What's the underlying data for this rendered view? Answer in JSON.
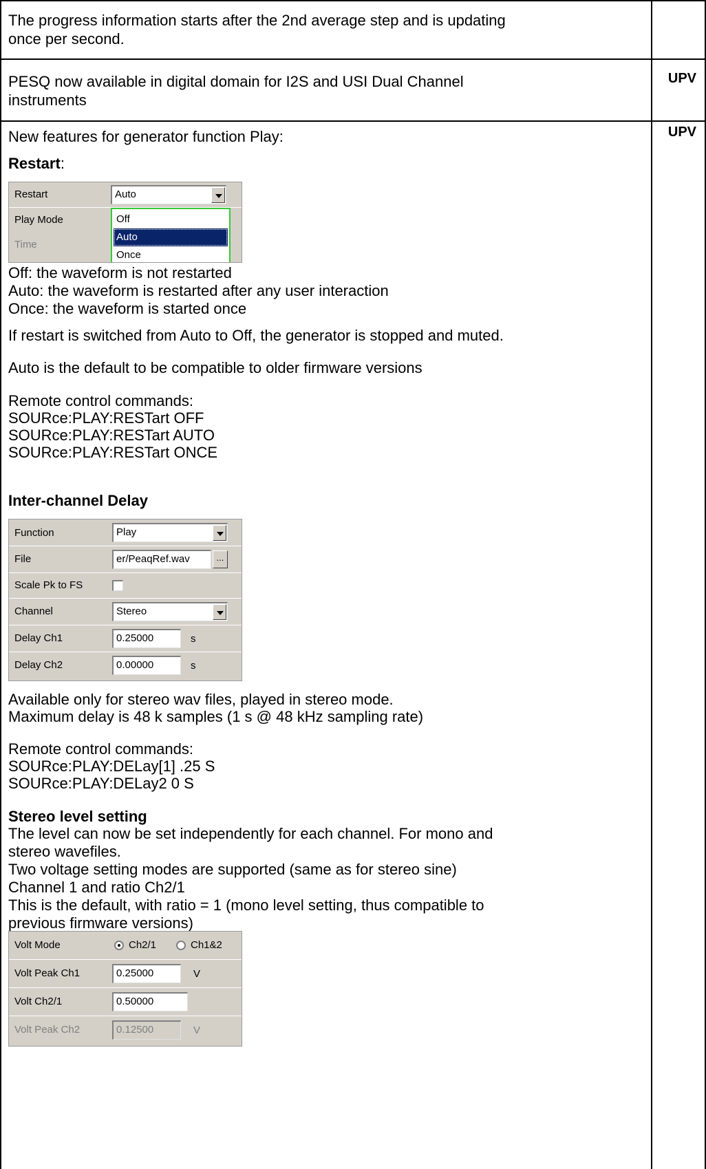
{
  "row1": {
    "lines": [
      "The progress information starts after the 2nd average step and is updating",
      "once per second."
    ],
    "tag": ""
  },
  "row2": {
    "lines": [
      "PESQ now available in digital domain for I2S and USI Dual Channel",
      "instruments"
    ],
    "tag": "UPV"
  },
  "row3": {
    "tag": "UPV",
    "intro": "New features for generator function Play:",
    "restart_heading": "Restart",
    "restart_heading_colon": ":",
    "restart_dialog": {
      "rows": [
        {
          "label": "Restart",
          "value": "Auto"
        },
        {
          "label": "Play Mode"
        },
        {
          "label": "Time"
        }
      ],
      "dropdown_options": [
        "Off",
        "Auto",
        "Once"
      ],
      "selected_option": "Auto"
    },
    "restart_desc": [
      "Off: the waveform is not restarted",
      "Auto: the waveform is restarted after any user interaction",
      "Once: the waveform is started once"
    ],
    "restart_note1": "If restart is switched from Auto to Off, the generator is stopped and muted.",
    "restart_note2": "Auto is the default to be compatible to older firmware versions",
    "restart_remote": [
      "Remote control commands:",
      "SOURce:PLAY:RESTart OFF",
      "SOURce:PLAY:RESTart AUTO",
      "SOURce:PLAY:RESTart ONCE"
    ],
    "delay_heading": "Inter-channel Delay",
    "delay_dialog": {
      "function_label": "Function",
      "function_value": "Play",
      "file_label": "File",
      "file_value": "er/PeaqRef.wav",
      "file_button": "...",
      "scale_label": "Scale Pk to FS",
      "channel_label": "Channel",
      "channel_value": "Stereo",
      "delay1_label": "Delay Ch1",
      "delay1_value": "0.25000",
      "delay1_unit": "s",
      "delay2_label": "Delay Ch2",
      "delay2_value": "0.00000",
      "delay2_unit": "s"
    },
    "delay_desc": [
      "Available only for stereo wav files, played in stereo mode.",
      "Maximum delay is 48 k samples (1 s @ 48 kHz sampling rate)"
    ],
    "delay_remote": [
      "Remote control commands:",
      "SOURce:PLAY:DELay[1] .25 S",
      "SOURce:PLAY:DELay2 0 S"
    ],
    "stereo_heading": "Stereo level setting",
    "stereo_desc": [
      "The level can now be set independently for each channel. For mono and",
      "stereo wavefiles.",
      "Two voltage setting modes are supported (same as for stereo sine)",
      "Channel 1 and ratio Ch2/1",
      "This is the default, with ratio = 1 (mono level setting, thus compatible to",
      "previous firmware versions)"
    ],
    "volt_dialog": {
      "mode_label": "Volt Mode",
      "mode_opt1": "Ch2/1",
      "mode_opt2": "Ch1&2",
      "peak1_label": "Volt Peak Ch1",
      "peak1_value": "0.25000",
      "peak1_unit": "V",
      "ratio_label": "Volt Ch2/1",
      "ratio_value": "0.50000",
      "peak2_label": "Volt Peak Ch2",
      "peak2_value": "0.12500",
      "peak2_unit": "V"
    }
  }
}
